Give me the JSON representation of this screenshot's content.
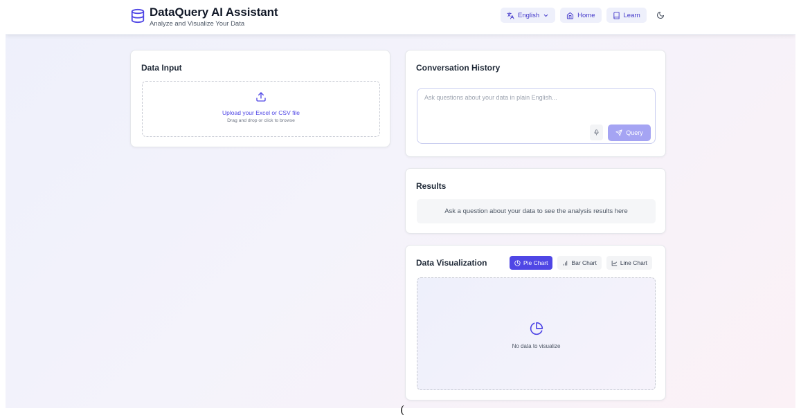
{
  "colors": {
    "accent": "#4f46e5",
    "accent_soft": "#a5a4f3",
    "nav_bg": "#eef0fb"
  },
  "header": {
    "title": "DataQuery AI Assistant",
    "subtitle": "Analyze and Visualize Your Data",
    "logo_icon": "database-icon",
    "nav": {
      "language": {
        "label": "English",
        "icon": "translate-icon"
      },
      "home": {
        "label": "Home",
        "icon": "home-icon"
      },
      "learn": {
        "label": "Learn",
        "icon": "book-icon"
      },
      "theme_icon": "moon-icon"
    }
  },
  "data_input": {
    "title": "Data Input",
    "upload_title": "Upload your Excel or CSV file",
    "upload_sub": "Drag and drop or click to browse",
    "upload_icon": "upload-icon"
  },
  "conversation": {
    "title": "Conversation History",
    "input_value": "",
    "input_placeholder": "Ask questions about your data in plain English...",
    "mic_icon": "mic-icon",
    "query_label": "Query",
    "query_icon": "send-icon"
  },
  "results": {
    "title": "Results",
    "empty_text": "Ask a question about your data to see the analysis results here"
  },
  "visualization": {
    "title": "Data Visualization",
    "tabs": [
      {
        "label": "Pie Chart",
        "icon": "pie-chart-icon",
        "active": true
      },
      {
        "label": "Bar Chart",
        "icon": "bar-chart-icon",
        "active": false
      },
      {
        "label": "Line Chart",
        "icon": "line-chart-icon",
        "active": false
      }
    ],
    "empty_text": "No data to visualize"
  },
  "footer": {
    "stray_char": "("
  }
}
